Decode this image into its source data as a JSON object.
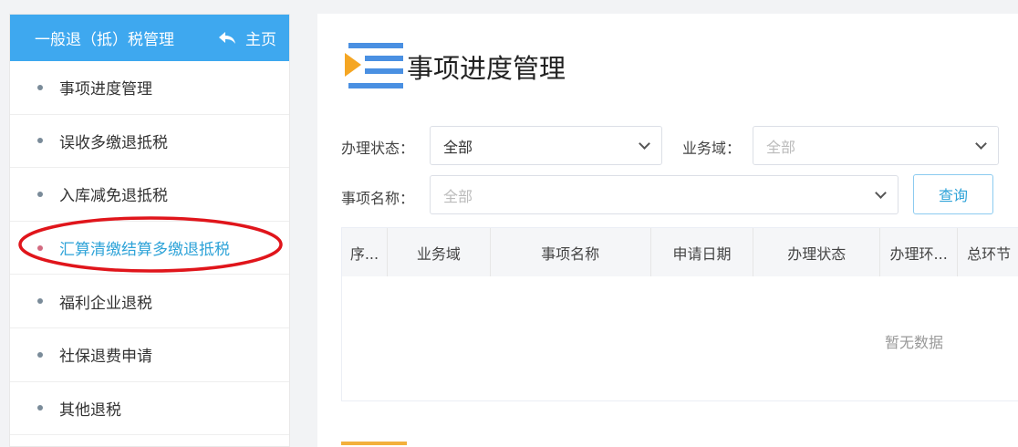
{
  "sidebar": {
    "title": "一般退（抵）税管理",
    "home_label": "主页",
    "items": [
      {
        "label": "事项进度管理"
      },
      {
        "label": "误收多缴退抵税"
      },
      {
        "label": "入库减免退抵税"
      },
      {
        "label": "汇算清缴结算多缴退抵税"
      },
      {
        "label": "福利企业退税"
      },
      {
        "label": "社保退费申请"
      },
      {
        "label": "其他退税"
      }
    ],
    "active_index": 3
  },
  "main": {
    "title": "事项进度管理",
    "filters": {
      "status_label": "办理状态：",
      "status_value": "全部",
      "domain_label": "业务域：",
      "domain_placeholder": "全部",
      "name_label": "事项名称：",
      "name_placeholder": "全部"
    },
    "query_label": "查询",
    "table": {
      "columns": [
        "序...",
        "业务域",
        "事项名称",
        "申请日期",
        "办理状态",
        "办理环...",
        "总环节"
      ],
      "empty_text": "暂无数据"
    }
  },
  "colors": {
    "header": "#3ea8ef",
    "accent": "#2ea3d8",
    "annotation": "#e0151b"
  }
}
